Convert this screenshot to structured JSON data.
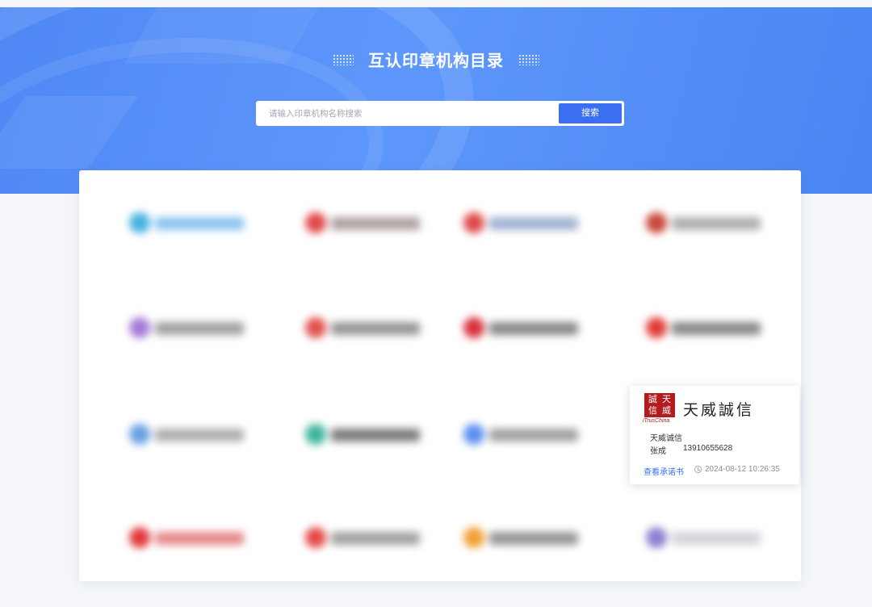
{
  "header": {
    "title": "互认印章机构目录",
    "search_placeholder": "请输入印章机构名称搜索",
    "search_button": "搜索"
  },
  "grid": {
    "rows": 4,
    "columns": 4,
    "logos": [
      {
        "icon_color": "#46b3e0",
        "text_color": "#6fb5e8"
      },
      {
        "icon_color": "#e0484a",
        "text_color": "#9a8a8a"
      },
      {
        "icon_color": "#e0484a",
        "text_color": "#8aa0c8"
      },
      {
        "icon_color": "#c8463a",
        "text_color": "#9a9a9a"
      },
      {
        "icon_color": "#a57ad6",
        "text_color": "#8a8a8a"
      },
      {
        "icon_color": "#e2504d",
        "text_color": "#7a7a7a"
      },
      {
        "icon_color": "#d8303a",
        "text_color": "#6a6a6a"
      },
      {
        "icon_color": "#e23a36",
        "text_color": "#6a6a6a"
      },
      {
        "icon_color": "#6aa0e0",
        "text_color": "#9a9a9a"
      },
      {
        "icon_color": "#3fb69c",
        "text_color": "#5a5a5a"
      },
      {
        "icon_color": "#5b8ef0",
        "text_color": "#8a8a8a"
      },
      null,
      {
        "icon_color": "#e2393b",
        "text_color": "#e06a6a"
      },
      {
        "icon_color": "#e84848",
        "text_color": "#8a8a8a"
      },
      {
        "icon_color": "#f2a033",
        "text_color": "#7a7a7a"
      },
      {
        "icon_color": "#8a80d0",
        "text_color": "#c8c8d0"
      }
    ]
  },
  "popup": {
    "seal_chars": [
      "誠",
      "天",
      "信",
      "威"
    ],
    "seal_caption": "iTrusChina",
    "brand_name": "天威誠信",
    "org_name": "天威诚信",
    "contact_name": "张成",
    "contact_phone": "13910655628",
    "link_label": "查看承诺书",
    "timestamp": "2024-08-12 10:26:35",
    "seal_color": "#b41b1e",
    "accent_color": "#3a6ff2"
  }
}
